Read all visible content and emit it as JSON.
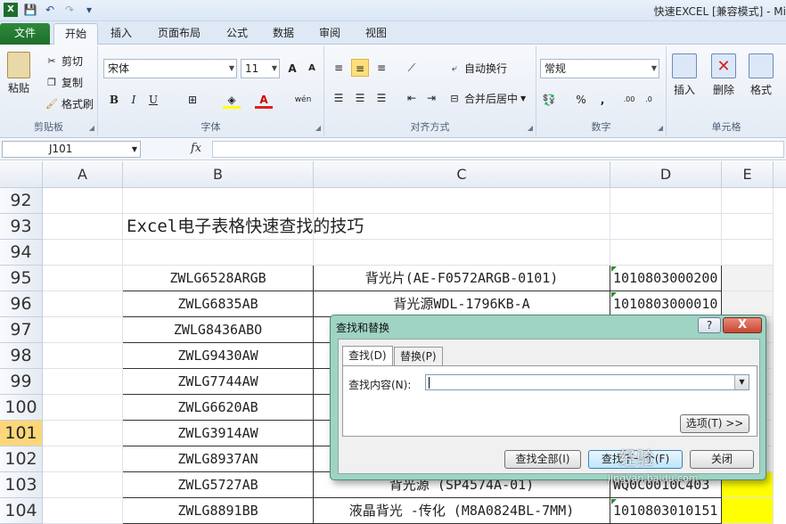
{
  "titlebar": {
    "title": "快速EXCEL [兼容模式] - Mi"
  },
  "tabs": [
    "文件",
    "开始",
    "插入",
    "页面布局",
    "公式",
    "数据",
    "审阅",
    "视图"
  ],
  "ribbon": {
    "clipboard": {
      "paste": "粘贴",
      "cut": "剪切",
      "copy": "复制",
      "format_painter": "格式刷",
      "label": "剪贴板"
    },
    "font": {
      "name": "宋体",
      "size": "11",
      "bold": "B",
      "italic": "I",
      "underline": "U",
      "label": "字体",
      "grow": "A",
      "shrink": "A"
    },
    "alignment": {
      "wrap": "自动换行",
      "merge": "合并后居中",
      "label": "对齐方式"
    },
    "number": {
      "format": "常规",
      "label": "数字",
      "percent": "%",
      "comma": ","
    },
    "cells": {
      "insert": "插入",
      "delete": "删除",
      "format": "格式",
      "label": "单元格"
    }
  },
  "formula_bar": {
    "name_box": "J101",
    "fx": "fx",
    "content": ""
  },
  "sheet": {
    "columns": [
      "A",
      "B",
      "C",
      "D",
      "E"
    ],
    "rows": [
      "92",
      "93",
      "94",
      "95",
      "96",
      "97",
      "98",
      "99",
      "100",
      "101",
      "102",
      "103",
      "104"
    ],
    "active_row": "101",
    "heading": "Excel电子表格快速查找的技巧",
    "b": [
      "ZWLG6528ARGB",
      "ZWLG6835AB",
      "ZWLG8436ABO",
      "ZWLG9430AW",
      "ZWLG7744AW",
      "ZWLG6620AB",
      "ZWLG3914AW",
      "ZWLG8937AN",
      "ZWLG5727AB",
      "ZWLG8891BB"
    ],
    "c": [
      "背光片(AE-F0572ARGB-0101)",
      "背光源WDL-1796KB-A",
      "",
      "",
      "",
      "",
      "",
      "",
      "背光源 (SP4574A-01)",
      "液晶背光 -传化 (M8A0824BL-7MM)"
    ],
    "d": [
      "1010803000200",
      "1010803000010",
      "",
      "",
      "",
      "",
      "",
      "",
      "WQ0C0010C403",
      "1010803010151"
    ]
  },
  "dialog": {
    "title": "查找和替换",
    "help": "?",
    "close": "X",
    "tab_find": "查找(D)",
    "tab_replace": "替换(P)",
    "find_label": "查找内容(N):",
    "find_value": "",
    "options": "选项(T) >>",
    "find_all": "查找全部(I)",
    "find_next": "查找下一个(F)",
    "close_btn": "关闭"
  },
  "watermark": {
    "main": "经验",
    "sub": "jingyan.baidu.com"
  }
}
